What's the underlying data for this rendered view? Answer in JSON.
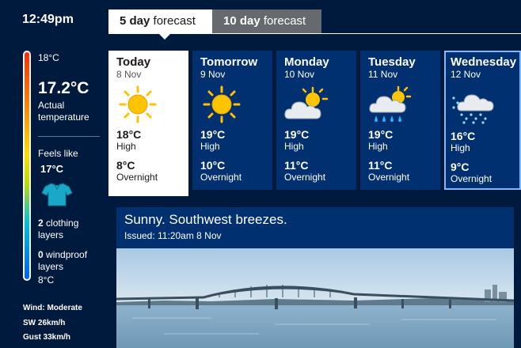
{
  "time": "12:49pm",
  "tabs": [
    {
      "bold": "5 day",
      "rest": " forecast",
      "active": true
    },
    {
      "bold": "10 day",
      "rest": " forecast",
      "active": false
    }
  ],
  "left_panel": {
    "max_label": "18°C",
    "current_temp": "17.2°C",
    "current_label_1": "Actual",
    "current_label_2": "temperature",
    "feels_like_label": "Feels like",
    "feels_like_value": "17°C",
    "clothing_count": "2",
    "clothing_label_1": " clothing",
    "clothing_label_2": "layers",
    "windproof_count": "0",
    "windproof_label_1": " windproof",
    "windproof_label_2": "layers",
    "min_label": "8°C",
    "wind_1": "Wind: Moderate",
    "wind_2": "SW 26km/h",
    "wind_3": "Gust 33km/h"
  },
  "forecast": [
    {
      "day": "Today",
      "date": "8 Nov",
      "icon": "sun-icon",
      "high": "18°C",
      "high_label": "High",
      "low": "8°C",
      "low_label": "Overnight"
    },
    {
      "day": "Tomorrow",
      "date": "9 Nov",
      "icon": "sun-icon",
      "high": "19°C",
      "high_label": "High",
      "low": "10°C",
      "low_label": "Overnight"
    },
    {
      "day": "Monday",
      "date": "10 Nov",
      "icon": "partly-cloudy-icon",
      "high": "19°C",
      "high_label": "High",
      "low": "11°C",
      "low_label": "Overnight"
    },
    {
      "day": "Tuesday",
      "date": "11 Nov",
      "icon": "showers-icon",
      "high": "19°C",
      "high_label": "High",
      "low": "11°C",
      "low_label": "Overnight"
    },
    {
      "day": "Wednesday",
      "date": "12 Nov",
      "icon": "drizzle-icon",
      "high": "16°C",
      "high_label": "High",
      "low": "9°C",
      "low_label": "Overnight"
    }
  ],
  "summary": {
    "title": "Sunny. Southwest breezes.",
    "issued": "Issued: 11:20am 8 Nov"
  },
  "colors": {
    "background": "#001a3d",
    "card": "#003070",
    "sun": "#ffc400",
    "selected_border": "#7fb8ff"
  }
}
